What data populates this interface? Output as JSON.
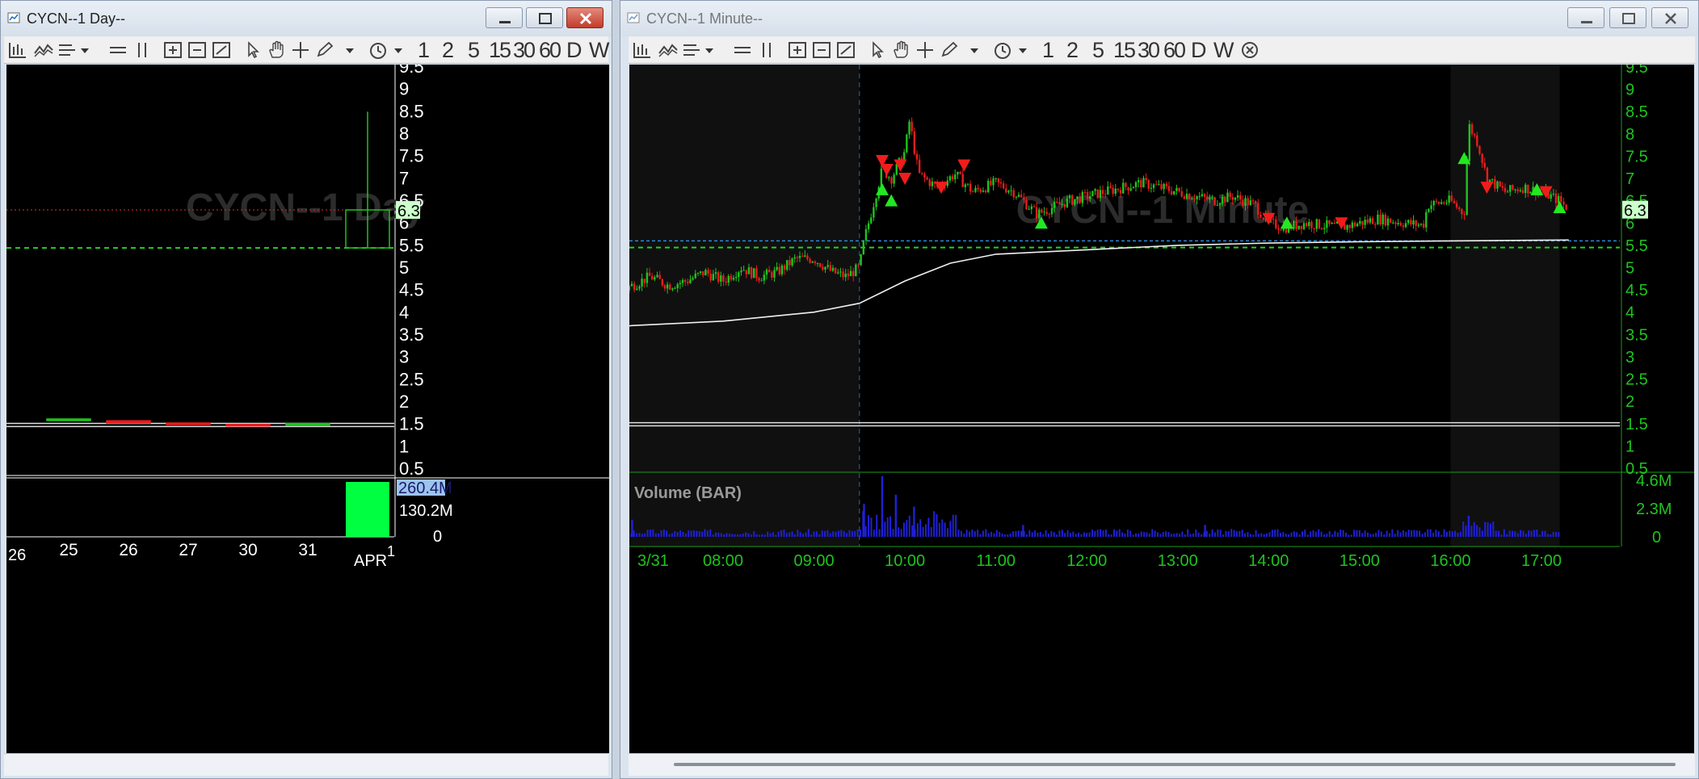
{
  "left_window": {
    "title": "CYCN--1 Day--",
    "watermark": "CYCN--1 Day",
    "toolbar_intervals": [
      "1",
      "2",
      "5",
      "15",
      "30",
      "60",
      "D",
      "W"
    ]
  },
  "right_window": {
    "title": "CYCN--1 Minute--",
    "watermark": "CYCN--1 Minute",
    "toolbar_intervals": [
      "1",
      "2",
      "5",
      "15",
      "30",
      "60",
      "D",
      "W"
    ]
  },
  "colors": {
    "up": "#1ec41e",
    "down": "#e81c1c",
    "volume_day": "#00ff41",
    "volume_minute": "#2020d8",
    "price_line": "#f0f0f0",
    "green_level": "#24d024",
    "blue_level": "#2a8ad8",
    "price_tag_bg": "#ccffcc"
  },
  "chart_data": [
    {
      "type": "candlestick",
      "name": "CYCN--1 Day",
      "x": [
        "25",
        "26",
        "27",
        "30",
        "31",
        "APR 1"
      ],
      "x_first_partial_label": "26",
      "ohlc": [
        {
          "o": 1.6,
          "h": 1.62,
          "l": 1.58,
          "c": 1.62
        },
        {
          "o": 1.58,
          "h": 1.58,
          "l": 1.53,
          "c": 1.53
        },
        {
          "o": 1.53,
          "h": 1.53,
          "l": 1.5,
          "c": 1.51
        },
        {
          "o": 1.5,
          "h": 1.5,
          "l": 1.46,
          "c": 1.47
        },
        {
          "o": 1.5,
          "h": 1.53,
          "l": 1.5,
          "c": 1.52
        },
        {
          "o": 5.45,
          "h": 8.5,
          "l": 5.45,
          "c": 6.3
        }
      ],
      "volume": [
        0,
        0,
        0,
        0,
        0,
        260.4
      ],
      "ylim": [
        0.5,
        9.5
      ],
      "yticks": [
        "9.5",
        "9",
        "8.5",
        "8",
        "7.5",
        "7",
        "6.5",
        "6",
        "5.5",
        "5",
        "4.5",
        "4",
        "3.5",
        "3",
        "2.5",
        "2",
        "1.5",
        "1",
        "0.5"
      ],
      "last_price_tag": "6.3",
      "levels": {
        "red_dotted": 6.3,
        "green_dashed": 5.45,
        "white_lines": [
          1.45,
          1.52
        ]
      },
      "volume_ticks": [
        "260.4M",
        "130.2M",
        "0"
      ],
      "volume_max": 260.4
    },
    {
      "type": "candlestick",
      "name": "CYCN--1 Minute",
      "x_ticks": [
        "3/31",
        "08:00",
        "09:00",
        "10:00",
        "11:00",
        "12:00",
        "13:00",
        "14:00",
        "15:00",
        "16:00",
        "17:00"
      ],
      "price_path": [
        [
          4.0,
          1.5
        ],
        [
          4.1,
          1.9
        ],
        [
          4.2,
          2.3
        ],
        [
          4.35,
          2.8
        ],
        [
          4.5,
          3.2
        ],
        [
          4.7,
          3.6
        ],
        [
          4.9,
          3.8
        ],
        [
          5.1,
          3.9
        ],
        [
          5.3,
          3.7
        ],
        [
          5.5,
          3.8
        ],
        [
          5.7,
          3.9
        ],
        [
          6.0,
          3.9
        ],
        [
          6.3,
          4.0
        ],
        [
          6.5,
          4.2
        ],
        [
          6.8,
          4.4
        ],
        [
          7.0,
          4.6
        ],
        [
          7.2,
          4.8
        ],
        [
          7.4,
          4.6
        ],
        [
          7.6,
          4.7
        ],
        [
          7.8,
          4.9
        ],
        [
          8.0,
          4.7
        ],
        [
          8.2,
          5.0
        ],
        [
          8.4,
          4.8
        ],
        [
          8.6,
          4.9
        ],
        [
          8.8,
          5.2
        ],
        [
          9.0,
          5.2
        ],
        [
          9.2,
          4.9
        ],
        [
          9.35,
          4.8
        ],
        [
          9.5,
          5.0
        ],
        [
          9.55,
          5.6
        ],
        [
          9.65,
          6.4
        ],
        [
          9.75,
          7.2
        ],
        [
          9.85,
          7.0
        ],
        [
          10.0,
          7.6
        ],
        [
          10.05,
          8.3
        ],
        [
          10.15,
          7.1
        ],
        [
          10.35,
          6.8
        ],
        [
          10.55,
          7.1
        ],
        [
          10.75,
          6.7
        ],
        [
          11.0,
          6.9
        ],
        [
          11.2,
          6.7
        ],
        [
          11.45,
          6.2
        ],
        [
          11.8,
          6.5
        ],
        [
          12.2,
          6.7
        ],
        [
          12.6,
          6.9
        ],
        [
          13.0,
          6.7
        ],
        [
          13.4,
          6.5
        ],
        [
          13.6,
          6.6
        ],
        [
          13.85,
          6.4
        ],
        [
          14.0,
          6.0
        ],
        [
          14.2,
          5.9
        ],
        [
          14.4,
          6.0
        ],
        [
          14.8,
          5.9
        ],
        [
          15.2,
          6.1
        ],
        [
          15.5,
          6.0
        ],
        [
          15.7,
          5.95
        ],
        [
          15.75,
          6.4
        ],
        [
          16.0,
          6.5
        ],
        [
          16.15,
          6.2
        ],
        [
          16.2,
          8.2
        ],
        [
          16.3,
          7.8
        ],
        [
          16.4,
          7.0
        ],
        [
          16.6,
          6.7
        ],
        [
          16.8,
          6.8
        ],
        [
          17.0,
          6.7
        ],
        [
          17.2,
          6.5
        ],
        [
          17.3,
          6.3
        ]
      ],
      "vwap": [
        [
          4.0,
          1.5
        ],
        [
          4.2,
          2.1
        ],
        [
          4.5,
          2.8
        ],
        [
          5.0,
          3.2
        ],
        [
          6.0,
          3.5
        ],
        [
          7.0,
          3.7
        ],
        [
          8.0,
          3.8
        ],
        [
          9.0,
          4.0
        ],
        [
          9.5,
          4.2
        ],
        [
          10.0,
          4.7
        ],
        [
          10.5,
          5.1
        ],
        [
          11.0,
          5.3
        ],
        [
          12.0,
          5.4
        ],
        [
          13.0,
          5.5
        ],
        [
          14.0,
          5.55
        ],
        [
          15.0,
          5.58
        ],
        [
          16.0,
          5.6
        ],
        [
          17.3,
          5.62
        ]
      ],
      "buy_arrows": [
        [
          9.75,
          6.75
        ],
        [
          9.85,
          6.5
        ],
        [
          11.5,
          6.0
        ],
        [
          14.2,
          6.0
        ],
        [
          16.15,
          7.45
        ],
        [
          16.95,
          6.75
        ],
        [
          17.2,
          6.35
        ]
      ],
      "sell_arrows": [
        [
          9.75,
          7.4
        ],
        [
          9.8,
          7.2
        ],
        [
          9.95,
          7.3
        ],
        [
          10.0,
          7.0
        ],
        [
          10.4,
          6.8
        ],
        [
          10.65,
          7.3
        ],
        [
          14.0,
          6.1
        ],
        [
          14.8,
          6.0
        ],
        [
          16.4,
          6.8
        ],
        [
          17.05,
          6.7
        ]
      ],
      "volume_spikes": [
        [
          9.75,
          4.6
        ],
        [
          9.9,
          3.2
        ],
        [
          9.55,
          2.5
        ],
        [
          10.1,
          2.3
        ],
        [
          5.2,
          1.6
        ],
        [
          6.1,
          1.4
        ],
        [
          7.0,
          1.3
        ],
        [
          16.2,
          1.6
        ],
        [
          11.3,
          0.9
        ],
        [
          13.3,
          0.9
        ]
      ],
      "ylim": [
        0.5,
        9.5
      ],
      "yticks": [
        "9.5",
        "9",
        "8.5",
        "8",
        "7.5",
        "7",
        "6.5",
        "6",
        "5.5",
        "5",
        "4.5",
        "4",
        "3.5",
        "3",
        "2.5",
        "2",
        "1.5",
        "1",
        "0.5"
      ],
      "last_price_tag": "6.3",
      "levels": {
        "blue_dotted": 5.6,
        "green_dashed": 5.45,
        "white_lines": [
          1.45,
          1.52
        ]
      },
      "volume_label": "Volume (BAR)",
      "volume_ticks": [
        "4.6M",
        "2.3M",
        "0"
      ],
      "volume_max": 4.6
    }
  ]
}
